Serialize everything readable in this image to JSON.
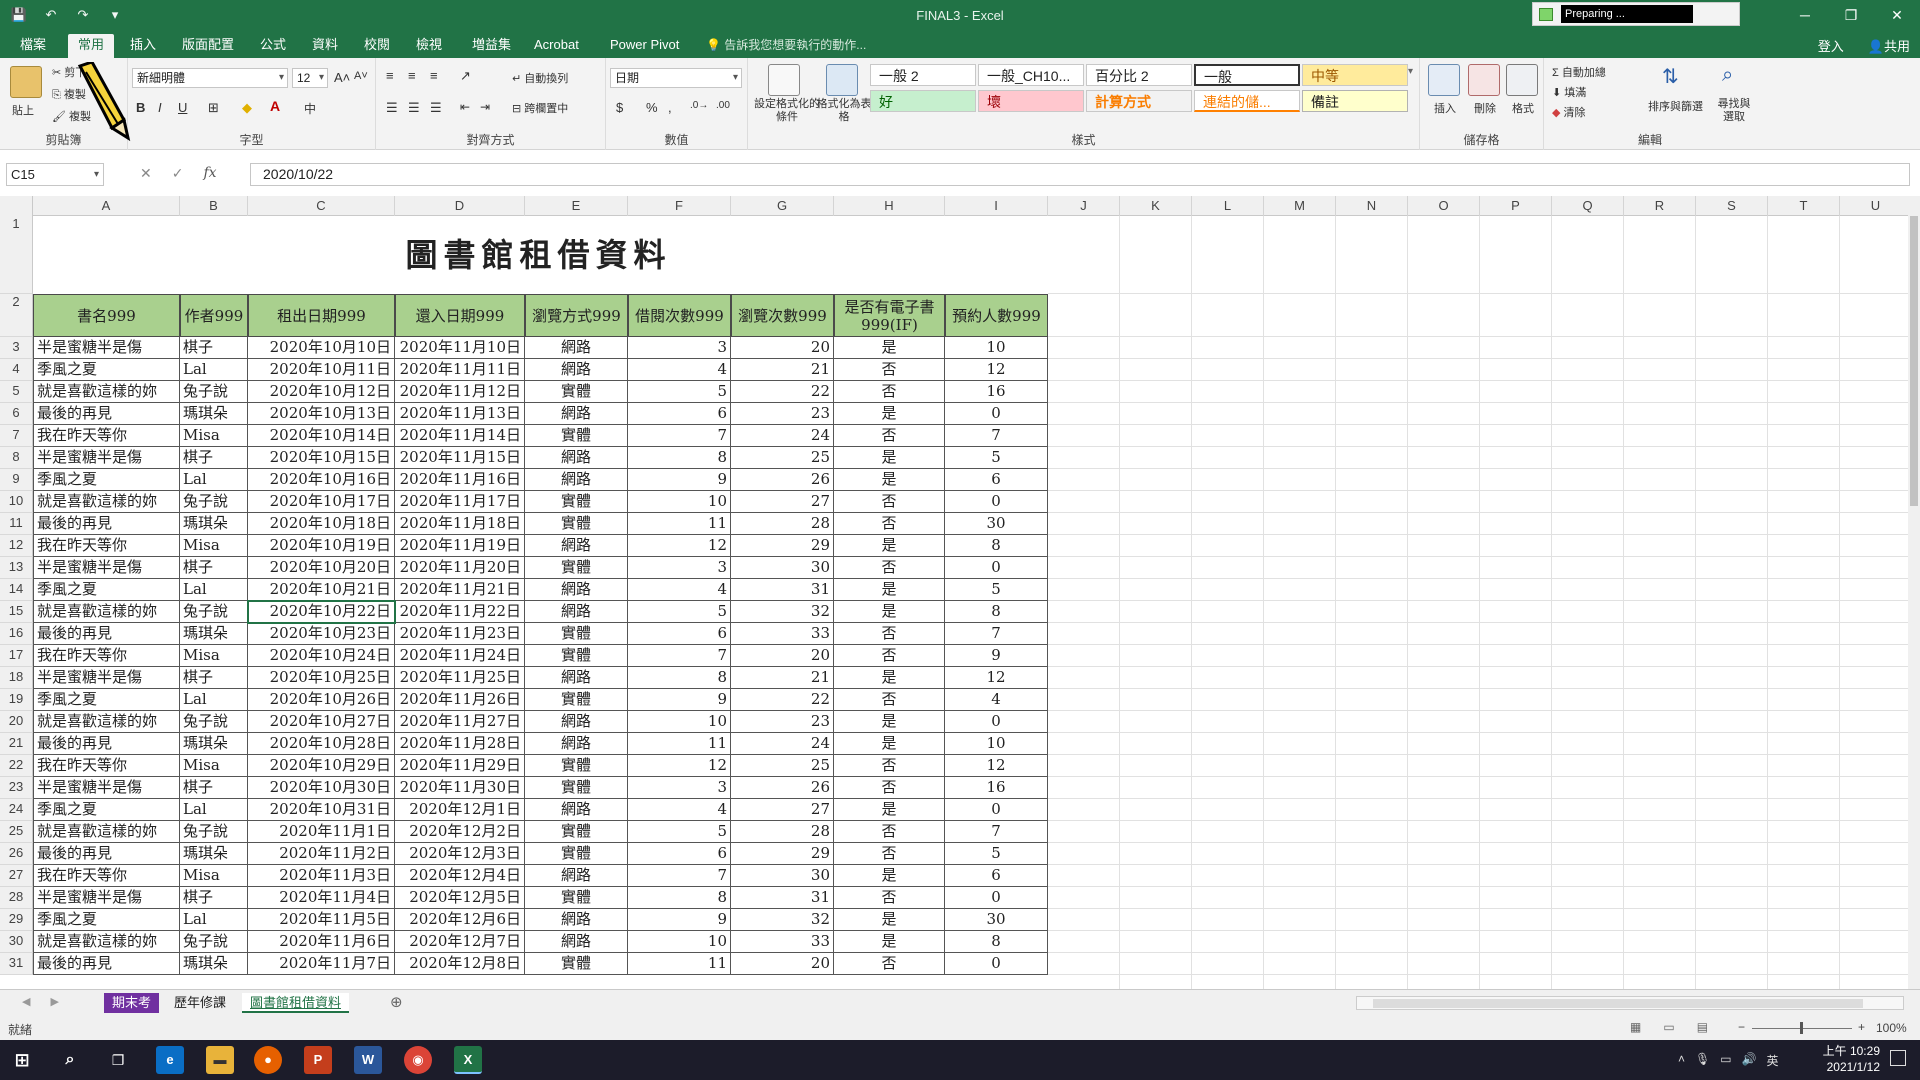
{
  "window": {
    "title": "FINAL3 - Excel",
    "progress_text": "Preparing ..."
  },
  "tabs": [
    {
      "label": "檔案"
    },
    {
      "label": "常用"
    },
    {
      "label": "插入"
    },
    {
      "label": "版面配置"
    },
    {
      "label": "公式"
    },
    {
      "label": "資料"
    },
    {
      "label": "校閱"
    },
    {
      "label": "檢視"
    },
    {
      "label": "増益集"
    },
    {
      "label": "Acrobat"
    },
    {
      "label": "Power Pivot"
    }
  ],
  "tell_me": "告訴我您想要執行的動作...",
  "account": {
    "signin": "登入",
    "share": "共用"
  },
  "ribbon": {
    "clipboard": {
      "paste": "貼上",
      "cut": "剪下",
      "copy": "複製",
      "format_painter": "複製",
      "label": "剪貼簿"
    },
    "font": {
      "name": "新細明體",
      "size": "12",
      "label": "字型"
    },
    "alignment": {
      "wrap": "自動換列",
      "merge": "跨欄置中",
      "label": "對齊方式"
    },
    "number": {
      "format": "日期",
      "label": "數值"
    },
    "styles": {
      "conditional": "設定格式化的條件",
      "table": "格式化為表格",
      "cells": [
        "一般 2",
        "一般_CH10...",
        "百分比 2",
        "一般",
        "中等",
        "好",
        "壞",
        "計算方式",
        "連結的儲...",
        "備註"
      ],
      "label": "樣式"
    },
    "cells_grp": {
      "insert": "插入",
      "delete": "刪除",
      "format": "格式",
      "label": "儲存格"
    },
    "editing": {
      "autosum": "自動加總",
      "fill": "填滿",
      "clear": "清除",
      "sort": "排序與篩選",
      "find": "尋找與選取",
      "label": "編輯"
    }
  },
  "formula_bar": {
    "namebox": "C15",
    "formula": "2020/10/22"
  },
  "columns": [
    "A",
    "B",
    "C",
    "D",
    "E",
    "F",
    "G",
    "H",
    "I",
    "J",
    "K",
    "L",
    "M",
    "N",
    "O",
    "P",
    "Q",
    "R",
    "S",
    "T",
    "U"
  ],
  "sheet": {
    "title": "圖書館租借資料",
    "headers": [
      "書名999",
      "作者999",
      "租出日期999",
      "還入日期999",
      "瀏覽方式999",
      "借閱次數999",
      "瀏覽次數999",
      "是否有電子書999(IF)",
      "預約人數999"
    ],
    "rows": [
      [
        "半是蜜糖半是傷",
        "棋子",
        "2020年10月10日",
        "2020年11月10日",
        "網路",
        "3",
        "20",
        "是",
        "10"
      ],
      [
        "季風之夏",
        "Lal",
        "2020年10月11日",
        "2020年11月11日",
        "網路",
        "4",
        "21",
        "否",
        "12"
      ],
      [
        "就是喜歡這樣的妳",
        "兔子說",
        "2020年10月12日",
        "2020年11月12日",
        "實體",
        "5",
        "22",
        "否",
        "16"
      ],
      [
        "最後的再見",
        "瑪琪朵",
        "2020年10月13日",
        "2020年11月13日",
        "網路",
        "6",
        "23",
        "是",
        "0"
      ],
      [
        "我在昨天等你",
        "Misa",
        "2020年10月14日",
        "2020年11月14日",
        "實體",
        "7",
        "24",
        "否",
        "7"
      ],
      [
        "半是蜜糖半是傷",
        "棋子",
        "2020年10月15日",
        "2020年11月15日",
        "網路",
        "8",
        "25",
        "是",
        "5"
      ],
      [
        "季風之夏",
        "Lal",
        "2020年10月16日",
        "2020年11月16日",
        "網路",
        "9",
        "26",
        "是",
        "6"
      ],
      [
        "就是喜歡這樣的妳",
        "兔子說",
        "2020年10月17日",
        "2020年11月17日",
        "實體",
        "10",
        "27",
        "否",
        "0"
      ],
      [
        "最後的再見",
        "瑪琪朵",
        "2020年10月18日",
        "2020年11月18日",
        "實體",
        "11",
        "28",
        "否",
        "30"
      ],
      [
        "我在昨天等你",
        "Misa",
        "2020年10月19日",
        "2020年11月19日",
        "網路",
        "12",
        "29",
        "是",
        "8"
      ],
      [
        "半是蜜糖半是傷",
        "棋子",
        "2020年10月20日",
        "2020年11月20日",
        "實體",
        "3",
        "30",
        "否",
        "0"
      ],
      [
        "季風之夏",
        "Lal",
        "2020年10月21日",
        "2020年11月21日",
        "網路",
        "4",
        "31",
        "是",
        "5"
      ],
      [
        "就是喜歡這樣的妳",
        "兔子說",
        "2020年10月22日",
        "2020年11月22日",
        "網路",
        "5",
        "32",
        "是",
        "8"
      ],
      [
        "最後的再見",
        "瑪琪朵",
        "2020年10月23日",
        "2020年11月23日",
        "實體",
        "6",
        "33",
        "否",
        "7"
      ],
      [
        "我在昨天等你",
        "Misa",
        "2020年10月24日",
        "2020年11月24日",
        "實體",
        "7",
        "20",
        "否",
        "9"
      ],
      [
        "半是蜜糖半是傷",
        "棋子",
        "2020年10月25日",
        "2020年11月25日",
        "網路",
        "8",
        "21",
        "是",
        "12"
      ],
      [
        "季風之夏",
        "Lal",
        "2020年10月26日",
        "2020年11月26日",
        "實體",
        "9",
        "22",
        "否",
        "4"
      ],
      [
        "就是喜歡這樣的妳",
        "兔子說",
        "2020年10月27日",
        "2020年11月27日",
        "網路",
        "10",
        "23",
        "是",
        "0"
      ],
      [
        "最後的再見",
        "瑪琪朵",
        "2020年10月28日",
        "2020年11月28日",
        "網路",
        "11",
        "24",
        "是",
        "10"
      ],
      [
        "我在昨天等你",
        "Misa",
        "2020年10月29日",
        "2020年11月29日",
        "實體",
        "12",
        "25",
        "否",
        "12"
      ],
      [
        "半是蜜糖半是傷",
        "棋子",
        "2020年10月30日",
        "2020年11月30日",
        "實體",
        "3",
        "26",
        "否",
        "16"
      ],
      [
        "季風之夏",
        "Lal",
        "2020年10月31日",
        "2020年12月1日",
        "網路",
        "4",
        "27",
        "是",
        "0"
      ],
      [
        "就是喜歡這樣的妳",
        "兔子說",
        "2020年11月1日",
        "2020年12月2日",
        "實體",
        "5",
        "28",
        "否",
        "7"
      ],
      [
        "最後的再見",
        "瑪琪朵",
        "2020年11月2日",
        "2020年12月3日",
        "實體",
        "6",
        "29",
        "否",
        "5"
      ],
      [
        "我在昨天等你",
        "Misa",
        "2020年11月3日",
        "2020年12月4日",
        "網路",
        "7",
        "30",
        "是",
        "6"
      ],
      [
        "半是蜜糖半是傷",
        "棋子",
        "2020年11月4日",
        "2020年12月5日",
        "實體",
        "8",
        "31",
        "否",
        "0"
      ],
      [
        "季風之夏",
        "Lal",
        "2020年11月5日",
        "2020年12月6日",
        "網路",
        "9",
        "32",
        "是",
        "30"
      ],
      [
        "就是喜歡這樣的妳",
        "兔子說",
        "2020年11月6日",
        "2020年12月7日",
        "網路",
        "10",
        "33",
        "是",
        "8"
      ],
      [
        "最後的再見",
        "瑪琪朵",
        "2020年11月7日",
        "2020年12月8日",
        "實體",
        "11",
        "20",
        "否",
        "0"
      ]
    ]
  },
  "sheet_tabs": [
    {
      "label": "期末考",
      "color": "#7030a0"
    },
    {
      "label": "歷年修課",
      "color": ""
    },
    {
      "label": "圖書館租借資料",
      "color": "#217346"
    }
  ],
  "status": {
    "ready": "就緒",
    "zoom": "100%"
  },
  "clock": {
    "time": "上午 10:29",
    "date": "2021/1/12"
  },
  "tray_lang": "英",
  "colors": {
    "excel_green": "#217346",
    "header_fill": "#a9d08e"
  }
}
